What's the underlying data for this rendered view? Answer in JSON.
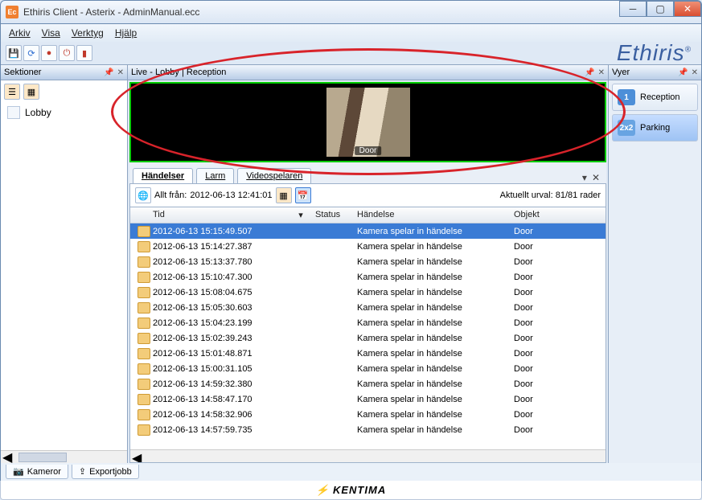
{
  "window": {
    "title": "Ethiris Client - Asterix - AdminManual.ecc",
    "icon_text": "Ec"
  },
  "menu": [
    "Arkiv",
    "Visa",
    "Verktyg",
    "Hjälp"
  ],
  "brand": "Ethiris",
  "panels": {
    "left_title": "Sektioner",
    "live_title": "Live - Lobby | Reception",
    "right_title": "Vyer",
    "tree_item": "Lobby",
    "camera_label": "Door"
  },
  "right_views": [
    {
      "chip": "1",
      "label": "Reception",
      "active": false
    },
    {
      "chip": "2x2",
      "label": "Parking",
      "active": true
    }
  ],
  "tabs": [
    "Händelser",
    "Larm",
    "Videospelaren"
  ],
  "events": {
    "allt_fran_label": "Allt från:",
    "allt_fran_value": "2012-06-13 12:41:01",
    "urval_label": "Aktuellt urval:",
    "urval_value": "81/81 rader",
    "headers": {
      "tid": "Tid",
      "status": "Status",
      "handelse": "Händelse",
      "objekt": "Objekt"
    },
    "rows": [
      {
        "t": "2012-06-13 15:15:49.507",
        "e": "Kamera spelar in händelse",
        "o": "Door",
        "sel": true
      },
      {
        "t": "2012-06-13 15:14:27.387",
        "e": "Kamera spelar in händelse",
        "o": "Door"
      },
      {
        "t": "2012-06-13 15:13:37.780",
        "e": "Kamera spelar in händelse",
        "o": "Door"
      },
      {
        "t": "2012-06-13 15:10:47.300",
        "e": "Kamera spelar in händelse",
        "o": "Door"
      },
      {
        "t": "2012-06-13 15:08:04.675",
        "e": "Kamera spelar in händelse",
        "o": "Door"
      },
      {
        "t": "2012-06-13 15:05:30.603",
        "e": "Kamera spelar in händelse",
        "o": "Door"
      },
      {
        "t": "2012-06-13 15:04:23.199",
        "e": "Kamera spelar in händelse",
        "o": "Door"
      },
      {
        "t": "2012-06-13 15:02:39.243",
        "e": "Kamera spelar in händelse",
        "o": "Door"
      },
      {
        "t": "2012-06-13 15:01:48.871",
        "e": "Kamera spelar in händelse",
        "o": "Door"
      },
      {
        "t": "2012-06-13 15:00:31.105",
        "e": "Kamera spelar in händelse",
        "o": "Door"
      },
      {
        "t": "2012-06-13 14:59:32.380",
        "e": "Kamera spelar in händelse",
        "o": "Door"
      },
      {
        "t": "2012-06-13 14:58:47.170",
        "e": "Kamera spelar in händelse",
        "o": "Door"
      },
      {
        "t": "2012-06-13 14:58:32.906",
        "e": "Kamera spelar in händelse",
        "o": "Door"
      },
      {
        "t": "2012-06-13 14:57:59.735",
        "e": "Kamera spelar in händelse",
        "o": "Door"
      }
    ]
  },
  "footer_tabs": [
    "Kameror",
    "Exportjobb"
  ],
  "branding": "KENTIMA"
}
